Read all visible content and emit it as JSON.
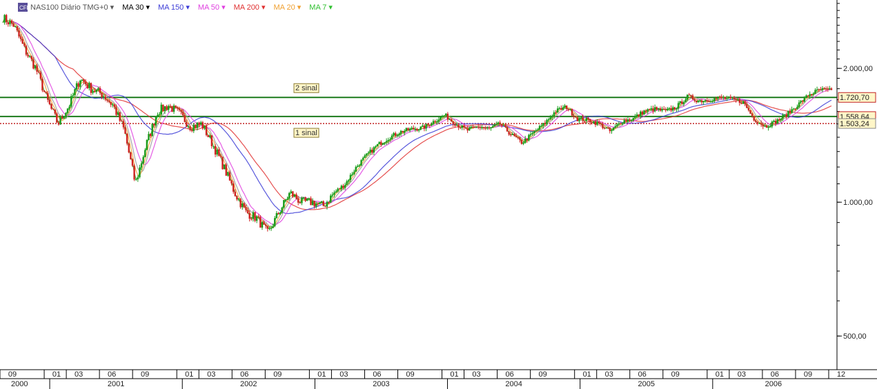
{
  "header": {
    "symbol": "NAS100",
    "period": "Diário",
    "tz": "TMG+0",
    "indicators": [
      {
        "label": "MA 30",
        "color": "#000000"
      },
      {
        "label": "MA 150",
        "color": "#3b3bd6"
      },
      {
        "label": "MA 50",
        "color": "#e040e0"
      },
      {
        "label": "MA 200",
        "color": "#e03030"
      },
      {
        "label": "MA 20",
        "color": "#f0a030"
      },
      {
        "label": "MA 7",
        "color": "#30c030"
      }
    ]
  },
  "chart_data": {
    "type": "line",
    "scale": "log",
    "ylim": [
      420,
      2850
    ],
    "yticks": [
      {
        "value": 2000,
        "label": "2.000,00"
      },
      {
        "value": 1000,
        "label": "1.000,00"
      },
      {
        "value": 500,
        "label": "500,00"
      }
    ],
    "levels": [
      {
        "name": "2 sinal",
        "value": 1720.7,
        "label": "1.720,70",
        "color": "#1b7a1b",
        "style": "solid"
      },
      {
        "name": "",
        "value": 1558.64,
        "label": "1.558,64",
        "color": "#1b7a1b",
        "style": "solid"
      },
      {
        "name": "1 sinal",
        "value": 1503.24,
        "label": "1.503,24",
        "color": "#c02020",
        "style": "dotted"
      }
    ],
    "x_month_ticks": [
      "09",
      "01",
      "03",
      "06",
      "09",
      "01",
      "03",
      "06",
      "09",
      "01",
      "03",
      "06",
      "09",
      "01",
      "03",
      "06",
      "09",
      "01",
      "03",
      "06",
      "09",
      "01",
      "03",
      "06",
      "09",
      "12"
    ],
    "x_year_labels": [
      "2000",
      "2001",
      "2002",
      "2003",
      "2004",
      "2005",
      "2006"
    ],
    "price_path": [
      {
        "t": "2000-09",
        "v": 2600
      },
      {
        "t": "2000-10",
        "v": 2500
      },
      {
        "t": "2000-11",
        "v": 2200
      },
      {
        "t": "2000-12",
        "v": 2000
      },
      {
        "t": "2001-01",
        "v": 1700
      },
      {
        "t": "2001-02",
        "v": 1500
      },
      {
        "t": "2001-03",
        "v": 1650
      },
      {
        "t": "2001-04",
        "v": 1900
      },
      {
        "t": "2001-05",
        "v": 1800
      },
      {
        "t": "2001-06",
        "v": 1750
      },
      {
        "t": "2001-07",
        "v": 1650
      },
      {
        "t": "2001-08",
        "v": 1450
      },
      {
        "t": "2001-09",
        "v": 1100
      },
      {
        "t": "2001-10",
        "v": 1350
      },
      {
        "t": "2001-11",
        "v": 1600
      },
      {
        "t": "2001-12",
        "v": 1650
      },
      {
        "t": "2002-01",
        "v": 1580
      },
      {
        "t": "2002-02",
        "v": 1480
      },
      {
        "t": "2002-03",
        "v": 1500
      },
      {
        "t": "2002-04",
        "v": 1350
      },
      {
        "t": "2002-05",
        "v": 1200
      },
      {
        "t": "2002-06",
        "v": 1050
      },
      {
        "t": "2002-07",
        "v": 950
      },
      {
        "t": "2002-08",
        "v": 920
      },
      {
        "t": "2002-09",
        "v": 850
      },
      {
        "t": "2002-10",
        "v": 950
      },
      {
        "t": "2002-11",
        "v": 1050
      },
      {
        "t": "2002-12",
        "v": 1000
      },
      {
        "t": "2003-01",
        "v": 1000
      },
      {
        "t": "2003-02",
        "v": 980
      },
      {
        "t": "2003-03",
        "v": 1050
      },
      {
        "t": "2003-04",
        "v": 1100
      },
      {
        "t": "2003-05",
        "v": 1200
      },
      {
        "t": "2003-06",
        "v": 1280
      },
      {
        "t": "2003-07",
        "v": 1350
      },
      {
        "t": "2003-08",
        "v": 1400
      },
      {
        "t": "2003-09",
        "v": 1440
      },
      {
        "t": "2003-10",
        "v": 1460
      },
      {
        "t": "2003-11",
        "v": 1470
      },
      {
        "t": "2003-12",
        "v": 1520
      },
      {
        "t": "2004-01",
        "v": 1570
      },
      {
        "t": "2004-02",
        "v": 1500
      },
      {
        "t": "2004-03",
        "v": 1450
      },
      {
        "t": "2004-04",
        "v": 1480
      },
      {
        "t": "2004-05",
        "v": 1460
      },
      {
        "t": "2004-06",
        "v": 1500
      },
      {
        "t": "2004-07",
        "v": 1420
      },
      {
        "t": "2004-08",
        "v": 1360
      },
      {
        "t": "2004-09",
        "v": 1430
      },
      {
        "t": "2004-10",
        "v": 1500
      },
      {
        "t": "2004-11",
        "v": 1600
      },
      {
        "t": "2004-12",
        "v": 1640
      },
      {
        "t": "2005-01",
        "v": 1540
      },
      {
        "t": "2005-02",
        "v": 1530
      },
      {
        "t": "2005-03",
        "v": 1500
      },
      {
        "t": "2005-04",
        "v": 1440
      },
      {
        "t": "2005-05",
        "v": 1520
      },
      {
        "t": "2005-06",
        "v": 1540
      },
      {
        "t": "2005-07",
        "v": 1600
      },
      {
        "t": "2005-08",
        "v": 1620
      },
      {
        "t": "2005-09",
        "v": 1600
      },
      {
        "t": "2005-10",
        "v": 1640
      },
      {
        "t": "2005-11",
        "v": 1730
      },
      {
        "t": "2005-12",
        "v": 1690
      },
      {
        "t": "2006-01",
        "v": 1700
      },
      {
        "t": "2006-02",
        "v": 1720
      },
      {
        "t": "2006-03",
        "v": 1700
      },
      {
        "t": "2006-04",
        "v": 1680
      },
      {
        "t": "2006-05",
        "v": 1540
      },
      {
        "t": "2006-06",
        "v": 1480
      },
      {
        "t": "2006-07",
        "v": 1520
      },
      {
        "t": "2006-08",
        "v": 1580
      },
      {
        "t": "2006-09",
        "v": 1660
      },
      {
        "t": "2006-10",
        "v": 1750
      },
      {
        "t": "2006-11",
        "v": 1790
      },
      {
        "t": "2006-12",
        "v": 1780
      }
    ]
  }
}
